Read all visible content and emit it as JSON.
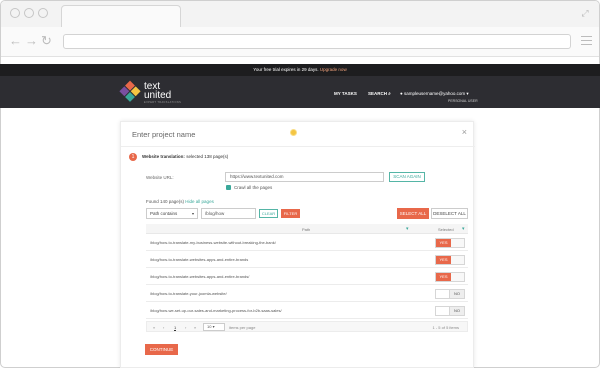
{
  "browser": {
    "url": ""
  },
  "banner": {
    "text": "Your free trial expires in 29 days.",
    "link": "Upgrade now"
  },
  "header": {
    "logo_line1": "text",
    "logo_line2": "united",
    "logo_sub": "EXPERT TRANSLATIONS",
    "nav": [
      "MY TASKS",
      "SEARCH"
    ],
    "account": "sampleusername@yahoo.com",
    "role": "PERSONAL USER",
    "logo_colors": [
      "#e8684a",
      "#f4c542",
      "#3aa89a",
      "#7a4fa0"
    ]
  },
  "modal": {
    "project_name_placeholder": "Enter project name",
    "close": "×",
    "step_number": "1",
    "step_title": "Website translation:",
    "step_info": "selected 138 page(s)",
    "website_url_label": "Website URL:",
    "website_url_value": "https://www.textunited.com",
    "scan_again": "SCAN AGAIN",
    "crawl_label": "Crawl all the pages",
    "crawl_checked": true,
    "found_text": "Found 140 page(s)",
    "hide_all": "Hide all pages",
    "filter_select": "Path contains",
    "filter_value": "/blog/how",
    "clear": "CLEAR",
    "filter": "FILTER",
    "select_all": "SELECT ALL",
    "deselect_all": "DESELECT ALL",
    "columns": [
      "Path",
      "Selected"
    ],
    "rows": [
      {
        "path": "/blog/how-to-translate-my-business-website-without-breaking-the-bank/",
        "selected": "YES"
      },
      {
        "path": "/blog/how-to-translate-websites-apps-and-entire-brands",
        "selected": "YES"
      },
      {
        "path": "/blog/how-to-translate-websites-apps-and-entire-brands/",
        "selected": "YES"
      },
      {
        "path": "/blog/how-to-translate-your-joomla-website/",
        "selected": "NO"
      },
      {
        "path": "/blog/how-we-set-up-our-sales-and-marketing-process-for-b2b-saas-sales/",
        "selected": "NO"
      }
    ],
    "pagination": {
      "first": "«",
      "prev": "‹",
      "current": "1",
      "next": "›",
      "last": "»",
      "per_page": "10",
      "per_page_label": "items per page",
      "info": "1 - 5 of 5 items"
    },
    "continue": "CONTINUE"
  }
}
